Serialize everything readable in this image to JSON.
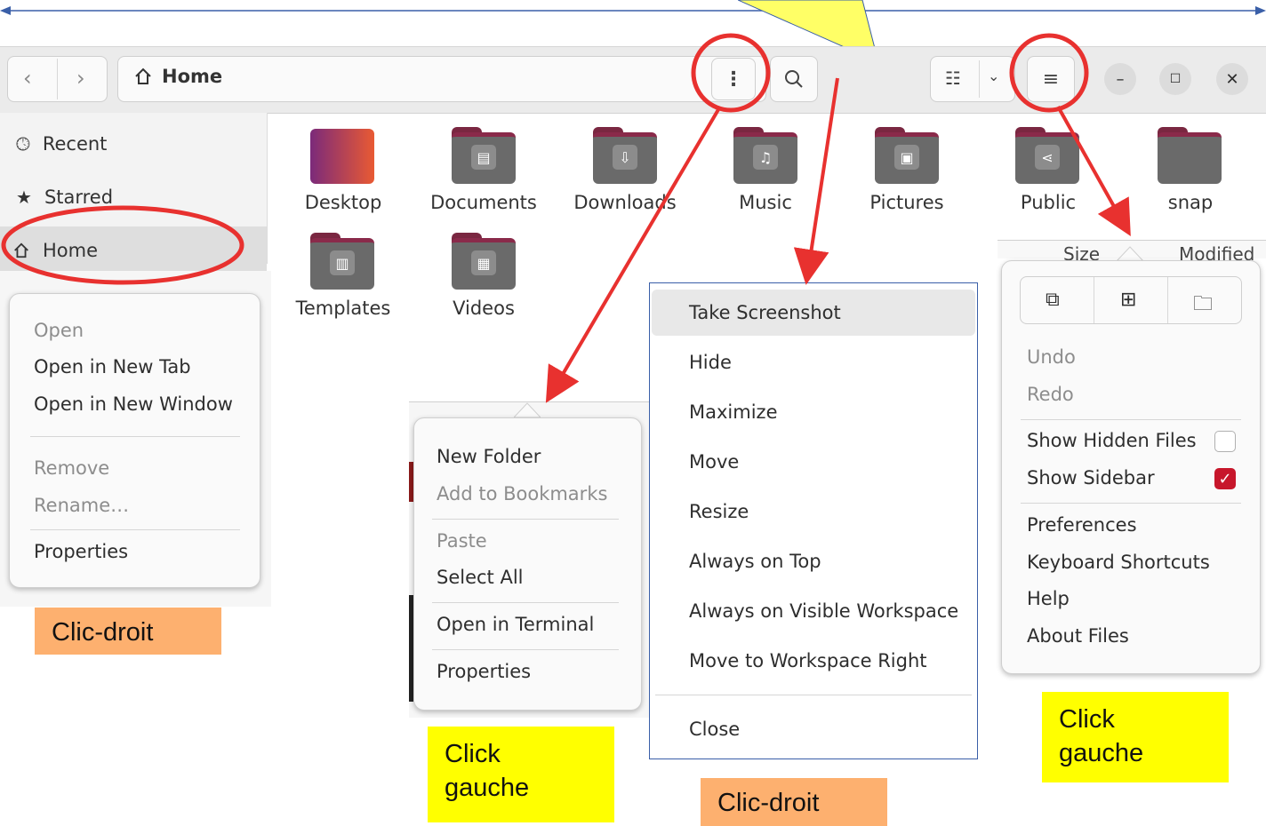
{
  "headerbar": {
    "path_title": "Home",
    "back_icon": "chevron-left-icon",
    "forward_icon": "chevron-right-icon",
    "home_icon": "home-icon",
    "kebab_icon": "vertical-ellipsis-icon",
    "search_icon": "search-icon",
    "view_icon": "list-view-icon",
    "view_dropdown_icon": "chevron-down-icon",
    "menu_icon": "hamburger-icon",
    "minimize_icon": "minimize-icon",
    "maximize_icon": "maximize-icon",
    "close_icon": "close-icon"
  },
  "sidebar": {
    "items": [
      {
        "label": "Recent",
        "icon": "clock-icon"
      },
      {
        "label": "Starred",
        "icon": "star-icon"
      },
      {
        "label": "Home",
        "icon": "home-icon"
      }
    ]
  },
  "folders": [
    {
      "label": "Desktop",
      "icon": "desktop-folder-icon"
    },
    {
      "label": "Documents",
      "icon": "documents-folder-icon"
    },
    {
      "label": "Downloads",
      "icon": "downloads-folder-icon"
    },
    {
      "label": "Music",
      "icon": "music-folder-icon"
    },
    {
      "label": "Pictures",
      "icon": "pictures-folder-icon"
    },
    {
      "label": "Public",
      "icon": "public-folder-icon"
    },
    {
      "label": "snap",
      "icon": "folder-icon"
    },
    {
      "label": "Templates",
      "icon": "templates-folder-icon"
    },
    {
      "label": "Videos",
      "icon": "videos-folder-icon"
    }
  ],
  "sidebar_context_menu": {
    "items": [
      "Open",
      "Open in New Tab",
      "Open in New Window",
      "Remove",
      "Rename…",
      "Properties"
    ]
  },
  "folder_menu": {
    "items": [
      "New Folder",
      "Add to Bookmarks",
      "Paste",
      "Select All",
      "Open in Terminal",
      "Properties"
    ]
  },
  "window_menu": {
    "items": [
      "Take Screenshot",
      "Hide",
      "Maximize",
      "Move",
      "Resize",
      "Always on Top",
      "Always on Visible Workspace",
      "Move to Workspace Right",
      "Close"
    ]
  },
  "main_menu": {
    "header_partial": [
      "Size",
      "Modified"
    ],
    "items": [
      "Undo",
      "Redo",
      "Show Hidden Files",
      "Show Sidebar",
      "Preferences",
      "Keyboard Shortcuts",
      "Help",
      "About Files"
    ],
    "show_hidden_files": false,
    "show_sidebar": true,
    "checkbox_color": "#c7162b"
  },
  "notes": {
    "left_right_click": "Clic-droit",
    "kebab_left_click": "Click\ngauche",
    "title_right_click": "Clic-droit",
    "menu_left_click": "Click\ngauche"
  },
  "colors": {
    "annotation_red": "#e8312f",
    "note_orange": "#fdb06f",
    "note_yellow": "#ffff00",
    "callout_yellow": "#ffff66",
    "arrow_blue": "#3a5fa8"
  }
}
